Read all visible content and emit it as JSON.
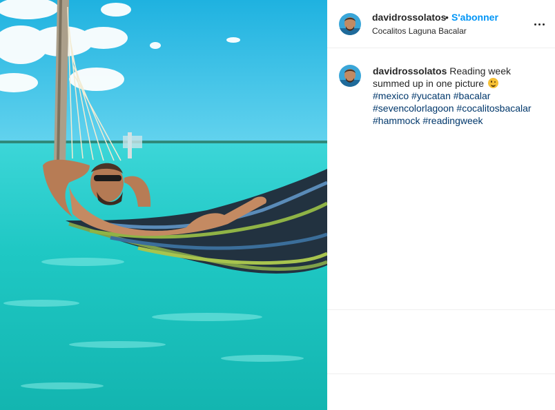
{
  "post": {
    "image_alt": "",
    "author": {
      "username": "davidrossolatos",
      "separator": "•",
      "follow_label": "S'abonner",
      "location": "Cocalitos Laguna Bacalar"
    },
    "caption": {
      "username": "davidrossolatos",
      "text": "Reading week summed up in one picture",
      "emoji": "smiling-face",
      "hashtags": [
        "#mexico",
        "#yucatan",
        "#bacalar",
        "#sevencolorlagoon",
        "#cocalitosbacalar",
        "#hammock",
        "#readingweek"
      ]
    },
    "more_icon": "more-horizontal-icon"
  },
  "colors": {
    "link_blue": "#0095f6",
    "hashtag_blue": "#00376b",
    "text": "#262626",
    "border": "#efefef"
  }
}
